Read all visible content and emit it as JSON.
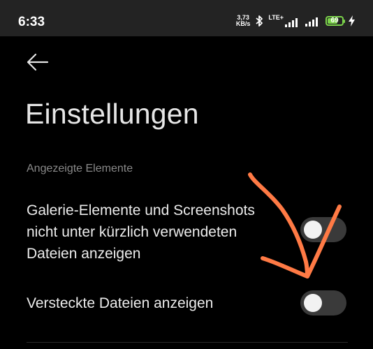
{
  "status_bar": {
    "time": "6:33",
    "net_speed_value": "3,73",
    "net_speed_unit": "KB/s",
    "network_label": "LTE+",
    "battery_level": "69",
    "battery_fraction": 0.69,
    "icons": [
      "bluetooth-icon",
      "signal-icon",
      "signal-icon",
      "battery-icon",
      "charging-icon"
    ],
    "battery_color": "#7bd34a"
  },
  "header": {
    "back_icon": "arrow-left-icon",
    "title": "Einstellungen"
  },
  "section": {
    "title": "Angezeigte Elemente",
    "items": [
      {
        "label": "Galerie-Elemente und Screenshots\nnicht unter kürzlich verwendeten\nDateien anzeigen",
        "enabled": false
      },
      {
        "label": "Versteckte Dateien anzeigen",
        "enabled": false
      }
    ]
  },
  "colors": {
    "background": "#000000",
    "status_bar": "#232323",
    "toggle_track": "#3a3a3a",
    "annotation": "#ff7a45"
  }
}
